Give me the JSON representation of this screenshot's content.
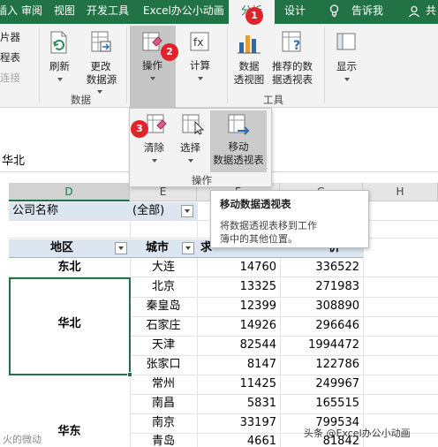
{
  "tabs": [
    {
      "label": "插入"
    },
    {
      "label": "审阅"
    },
    {
      "label": "视图"
    },
    {
      "label": "开发工具"
    },
    {
      "label": "Excel办公小动画"
    },
    {
      "label": "分析",
      "active": true
    },
    {
      "label": "设计"
    },
    {
      "label": "告诉我"
    },
    {
      "label": "共"
    }
  ],
  "ribbon": {
    "left_items": [
      "片器",
      "程表",
      "连接"
    ],
    "refresh": "刷新",
    "change_source": [
      "更改",
      "数据源"
    ],
    "data_group": "数据",
    "actions": "操作",
    "calculations": "计算",
    "pivot_chart": [
      "数据",
      "透视图"
    ],
    "recommended": [
      "推荐的数",
      "据透视表"
    ],
    "tools_group": "工具",
    "show": "显示"
  },
  "actions_panel": {
    "clear": "清除",
    "select": "选择",
    "move": [
      "移动",
      "数据透视表"
    ],
    "group_label": "操作"
  },
  "badges": [
    "1",
    "2",
    "3"
  ],
  "formula_bar": {
    "value": "华北"
  },
  "columns": [
    "D",
    "E",
    "F",
    "G",
    "H"
  ],
  "filter": {
    "label": "公司名称",
    "value": "(全部)"
  },
  "table_headers": {
    "region": "地区",
    "city": "城市",
    "c3": "求",
    "c4": "价"
  },
  "rows": [
    {
      "region": "东北",
      "city": "大连",
      "v1": "14760",
      "v2": "336522"
    },
    {
      "region": "",
      "city": "北京",
      "v1": "13325",
      "v2": "271983"
    },
    {
      "region": "",
      "city": "秦皇岛",
      "v1": "12399",
      "v2": "308890"
    },
    {
      "region": "华北",
      "city": "石家庄",
      "v1": "14926",
      "v2": "296646"
    },
    {
      "region": "",
      "city": "天津",
      "v1": "82544",
      "v2": "1994472"
    },
    {
      "region": "",
      "city": "张家口",
      "v1": "8147",
      "v2": "122786"
    },
    {
      "region": "",
      "city": "常州",
      "v1": "11425",
      "v2": "249967"
    },
    {
      "region": "",
      "city": "南昌",
      "v1": "5831",
      "v2": "165515"
    },
    {
      "region": "华东",
      "city": "南京",
      "v1": "33197",
      "v2": "799534"
    },
    {
      "region": "",
      "city": "青岛",
      "v1": "4661",
      "v2": "81842"
    }
  ],
  "tooltip": {
    "title": "移动数据透视表",
    "body1": "将数据透视表移到工作",
    "body2": "簿中的其他位置。"
  },
  "watermarks": {
    "left": "火的微动",
    "right": "头条 @Excel办公小动画"
  }
}
